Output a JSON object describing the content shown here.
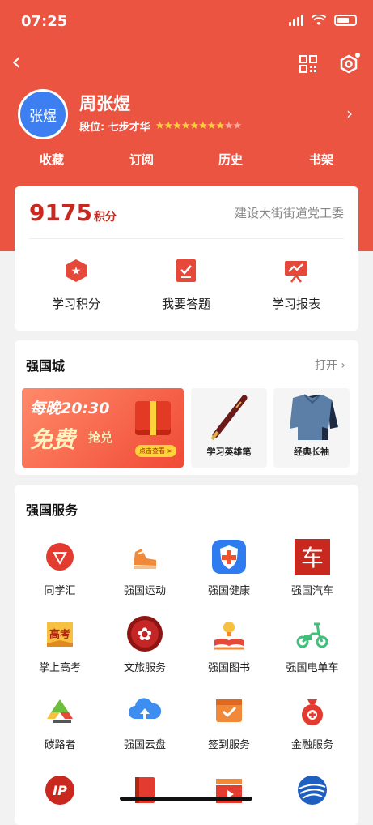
{
  "status_bar": {
    "time": "07:25"
  },
  "profile": {
    "avatar_text": "张煜",
    "name": "周张煜",
    "rank_label": "段位: 七步才华",
    "stars": "★★★★★★★★★★"
  },
  "tabs": [
    "收藏",
    "订阅",
    "历史",
    "书架"
  ],
  "points": {
    "value": "9175",
    "unit": "积分",
    "org": "建设大街街道党工委"
  },
  "quick_actions": [
    {
      "label": "学习积分",
      "icon": "points-icon"
    },
    {
      "label": "我要答题",
      "icon": "quiz-icon"
    },
    {
      "label": "学习报表",
      "icon": "report-icon"
    }
  ],
  "mall": {
    "title": "强国城",
    "open_label": "打开 ›",
    "banner": {
      "line1": "每晚20:30",
      "line2": "免费",
      "line3": "抢兑",
      "cta": "点击查看 >"
    },
    "products": [
      {
        "label": "学习英雄笔"
      },
      {
        "label": "经典长袖"
      }
    ]
  },
  "services": {
    "title": "强国服务",
    "items": [
      {
        "label": "同学汇",
        "icon": "tongxuehui-icon",
        "color": "#e33b2f"
      },
      {
        "label": "强国运动",
        "icon": "sneaker-icon",
        "color": "#f08a3a"
      },
      {
        "label": "强国健康",
        "icon": "health-shield-icon",
        "color": "#2f7cf0"
      },
      {
        "label": "强国汽车",
        "icon": "car-character-icon",
        "color": "#c8281d"
      },
      {
        "label": "掌上高考",
        "icon": "gaokao-icon",
        "color": "#f0a030"
      },
      {
        "label": "文旅服务",
        "icon": "culture-travel-icon",
        "color": "#a01818"
      },
      {
        "label": "强国图书",
        "icon": "book-lamp-icon",
        "color": "#f08a3a"
      },
      {
        "label": "强国电单车",
        "icon": "scooter-icon",
        "color": "#3fbf7a"
      },
      {
        "label": "碳路者",
        "icon": "carbon-leaf-icon",
        "color": "#6cbf3a"
      },
      {
        "label": "强国云盘",
        "icon": "cloud-upload-icon",
        "color": "#3d8ef0"
      },
      {
        "label": "签到服务",
        "icon": "checkin-icon",
        "color": "#f08a3a"
      },
      {
        "label": "金融服务",
        "icon": "money-bag-icon",
        "color": "#e33b2f"
      },
      {
        "label": "",
        "icon": "ip-icon",
        "color": "#c8281d"
      },
      {
        "label": "",
        "icon": "book-red-icon",
        "color": "#e33b2f"
      },
      {
        "label": "",
        "icon": "video-clapper-icon",
        "color": "#e33b2f"
      },
      {
        "label": "",
        "icon": "globe-icon",
        "color": "#1f5fbf"
      }
    ]
  }
}
